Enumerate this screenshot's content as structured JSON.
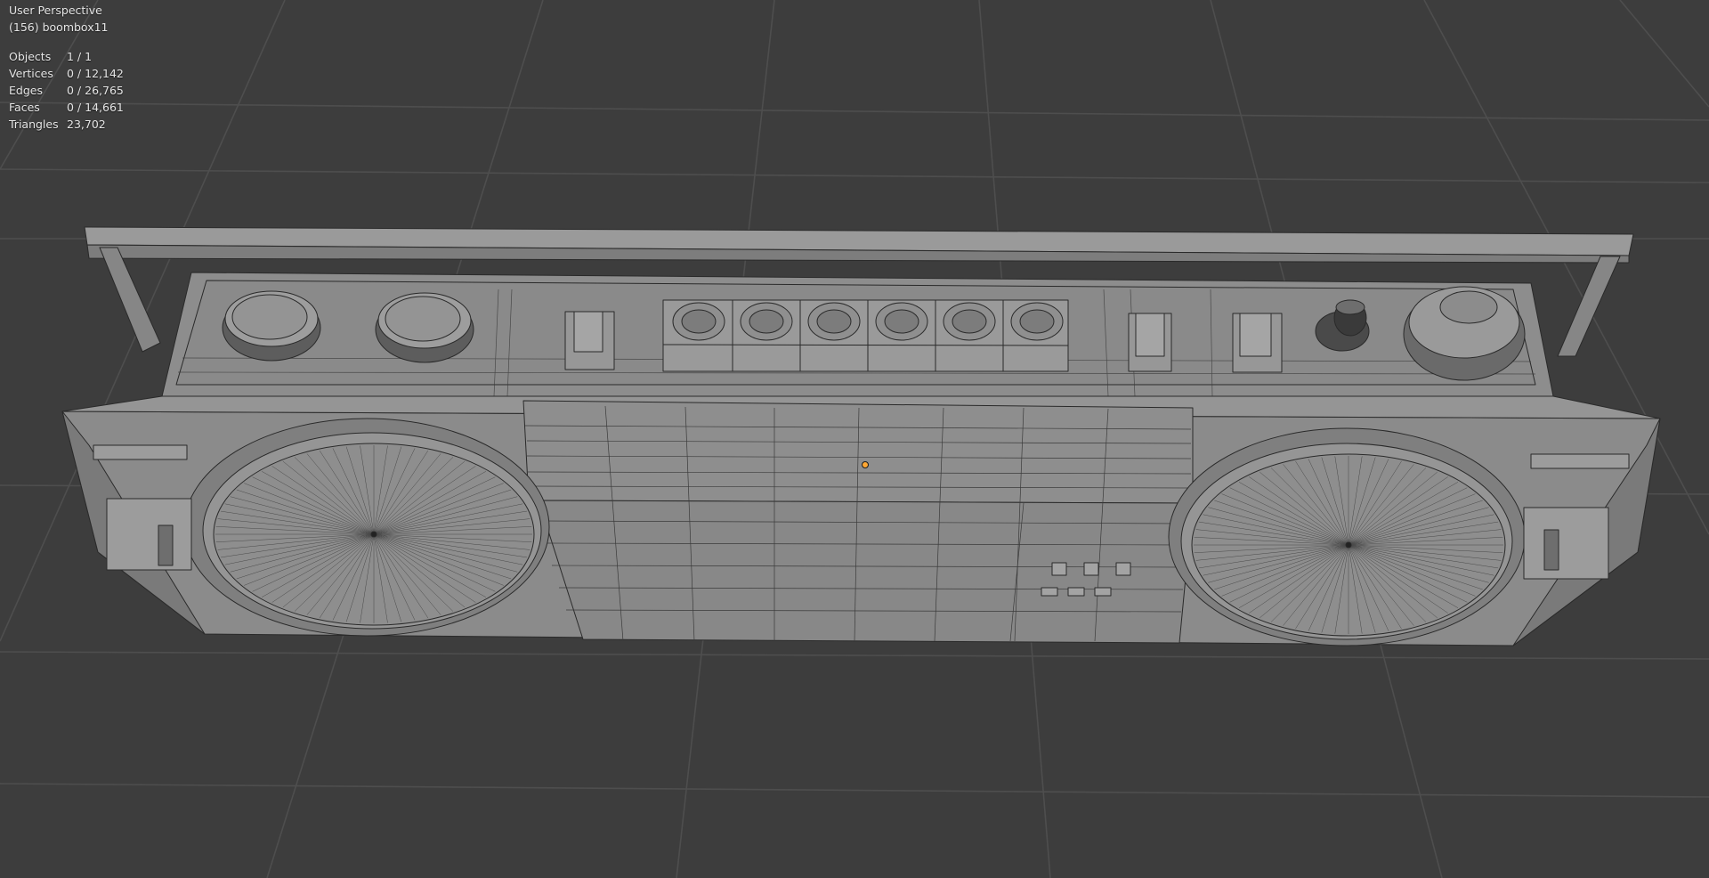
{
  "viewport": {
    "view_name": "User Perspective",
    "object_name": "(156) boombox11",
    "background": "#3d3d3d",
    "grid_color": "#4f4f4f",
    "mesh_color": "#8a8a8a",
    "origin_color": "#ffa733"
  },
  "stats": [
    {
      "label": "Objects",
      "value": "1 / 1"
    },
    {
      "label": "Vertices",
      "value": "0 / 12,142"
    },
    {
      "label": "Edges",
      "value": "0 / 26,765"
    },
    {
      "label": "Faces",
      "value": "0 / 14,661"
    },
    {
      "label": "Triangles",
      "value": "23,702"
    }
  ]
}
